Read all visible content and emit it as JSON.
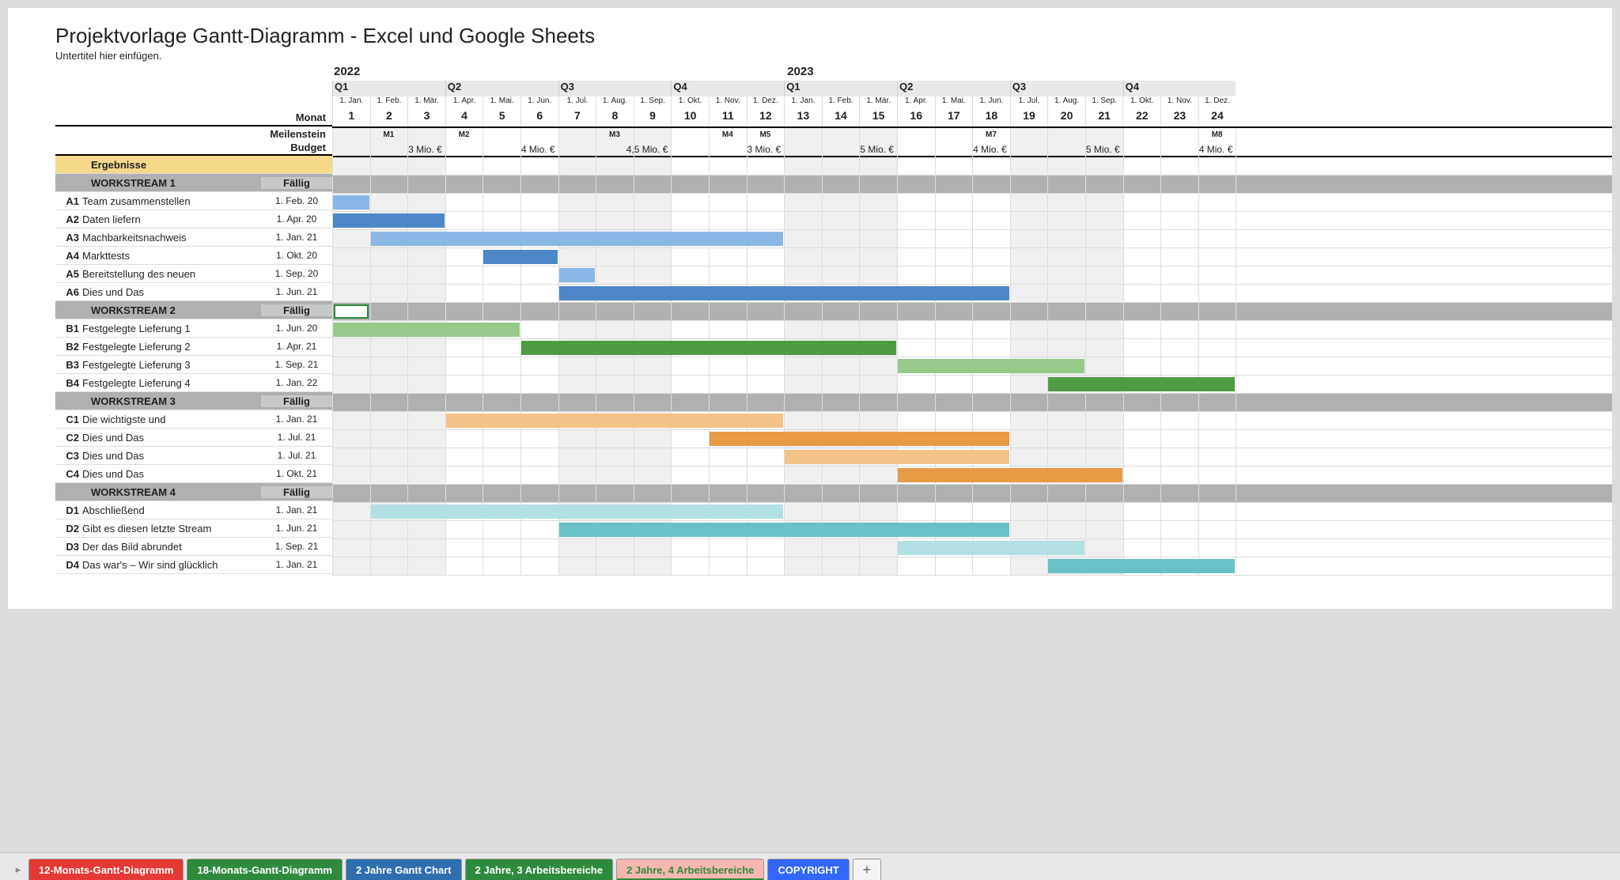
{
  "title": "Projektvorlage Gantt-Diagramm - Excel und Google Sheets",
  "subtitle": "Untertitel hier einfügen.",
  "left_headers": {
    "monat": "Monat",
    "meilenstein": "Meilenstein",
    "budget": "Budget",
    "ergebnisse": "Ergebnisse",
    "fallig": "Fällig"
  },
  "years": [
    "2022",
    "2023"
  ],
  "quarters": [
    "Q1",
    "Q2",
    "Q3",
    "Q4",
    "Q1",
    "Q2",
    "Q3",
    "Q4"
  ],
  "month_dates": [
    "1. Jan.",
    "1. Feb.",
    "1. Mär.",
    "1. Apr.",
    "1. Mai.",
    "1. Jun.",
    "1. Jul.",
    "1. Aug.",
    "1. Sep.",
    "1. Okt.",
    "1. Nov.",
    "1. Dez.",
    "1. Jan.",
    "1. Feb.",
    "1. Mär.",
    "1. Apr.",
    "1. Mai.",
    "1. Jun.",
    "1. Jul.",
    "1. Aug.",
    "1. Sep.",
    "1. Okt.",
    "1. Nov.",
    "1. Dez."
  ],
  "month_nums": [
    "1",
    "2",
    "3",
    "4",
    "5",
    "6",
    "7",
    "8",
    "9",
    "10",
    "11",
    "12",
    "13",
    "14",
    "15",
    "16",
    "17",
    "18",
    "19",
    "20",
    "21",
    "22",
    "23",
    "24"
  ],
  "milestones": [
    {
      "col": 2,
      "label": "M1"
    },
    {
      "col": 4,
      "label": "M2"
    },
    {
      "col": 8,
      "label": "M3"
    },
    {
      "col": 11,
      "label": "M4"
    },
    {
      "col": 12,
      "label": "M5"
    },
    {
      "col": 18,
      "label": "M7"
    },
    {
      "col": 24,
      "label": "M8"
    }
  ],
  "budgets": [
    {
      "end_col": 3,
      "label": "3 Mio. €"
    },
    {
      "end_col": 6,
      "label": "4 Mio. €"
    },
    {
      "end_col": 9,
      "label": "4,5 Mio. €"
    },
    {
      "end_col": 12,
      "label": "3 Mio. €"
    },
    {
      "end_col": 15,
      "label": "5 Mio. €"
    },
    {
      "end_col": 18,
      "label": "4 Mio. €"
    },
    {
      "end_col": 21,
      "label": "5 Mio. €"
    },
    {
      "end_col": 24,
      "label": "4 Mio. €"
    }
  ],
  "workstreams": [
    {
      "name": "WORKSTREAM 1",
      "color_light": "#8ab7e6",
      "color_dark": "#4d87c7",
      "select_first_cell": false,
      "tasks": [
        {
          "id": "A1",
          "name": "Team zusammenstellen",
          "due": "1. Feb. 20",
          "start": 1,
          "len": 1,
          "shade": "light"
        },
        {
          "id": "A2",
          "name": "Daten liefern",
          "due": "1. Apr. 20",
          "start": 1,
          "len": 3,
          "shade": "dark"
        },
        {
          "id": "A3",
          "name": "Machbarkeitsnachweis",
          "due": "1. Jan. 21",
          "start": 2,
          "len": 11,
          "shade": "light"
        },
        {
          "id": "A4",
          "name": "Markttests",
          "due": "1. Okt. 20",
          "start": 5,
          "len": 2,
          "shade": "dark"
        },
        {
          "id": "A5",
          "name": "Bereitstellung des neuen",
          "due": "1. Sep. 20",
          "start": 7,
          "len": 1,
          "shade": "light"
        },
        {
          "id": "A6",
          "name": "Dies und Das",
          "due": "1. Jun. 21",
          "start": 7,
          "len": 12,
          "shade": "dark"
        }
      ]
    },
    {
      "name": "WORKSTREAM 2",
      "color_light": "#96c98a",
      "color_dark": "#4f9b44",
      "select_first_cell": true,
      "tasks": [
        {
          "id": "B1",
          "name": "Festgelegte Lieferung 1",
          "due": "1. Jun. 20",
          "start": 1,
          "len": 5,
          "shade": "light"
        },
        {
          "id": "B2",
          "name": "Festgelegte Lieferung 2",
          "due": "1. Apr. 21",
          "start": 6,
          "len": 10,
          "shade": "dark"
        },
        {
          "id": "B3",
          "name": "Festgelegte Lieferung 3",
          "due": "1. Sep. 21",
          "start": 16,
          "len": 5,
          "shade": "light"
        },
        {
          "id": "B4",
          "name": "Festgelegte Lieferung 4",
          "due": "1. Jan. 22",
          "start": 20,
          "len": 5,
          "shade": "dark"
        }
      ]
    },
    {
      "name": "WORKSTREAM 3",
      "color_light": "#f3c38a",
      "color_dark": "#e89a45",
      "select_first_cell": false,
      "tasks": [
        {
          "id": "C1",
          "name": "Die wichtigste und",
          "due": "1. Jan. 21",
          "start": 4,
          "len": 9,
          "shade": "light"
        },
        {
          "id": "C2",
          "name": "Dies und Das",
          "due": "1. Jul. 21",
          "start": 11,
          "len": 8,
          "shade": "dark"
        },
        {
          "id": "C3",
          "name": "Dies und Das",
          "due": "1. Jul. 21",
          "start": 13,
          "len": 6,
          "shade": "light"
        },
        {
          "id": "C4",
          "name": "Dies und Das",
          "due": "1. Okt. 21",
          "start": 16,
          "len": 6,
          "shade": "dark"
        }
      ]
    },
    {
      "name": "WORKSTREAM 4",
      "color_light": "#b2e0e2",
      "color_dark": "#6ac1c6",
      "select_first_cell": false,
      "tasks": [
        {
          "id": "D1",
          "name": "Abschließend",
          "due": "1. Jan. 21",
          "start": 2,
          "len": 11,
          "shade": "light"
        },
        {
          "id": "D2",
          "name": "Gibt es diesen letzte Stream",
          "due": "1. Jun. 21",
          "start": 7,
          "len": 12,
          "shade": "dark"
        },
        {
          "id": "D3",
          "name": "Der das Bild abrundet",
          "due": "1. Sep. 21",
          "start": 16,
          "len": 5,
          "shade": "light"
        },
        {
          "id": "D4",
          "name": "Das war's – Wir sind glücklich",
          "due": "1. Jan. 21",
          "start": 20,
          "len": 5,
          "shade": "dark"
        }
      ]
    }
  ],
  "tabs": [
    {
      "label": "12-Monats-Gantt-Diagramm",
      "bg": "#e53935",
      "fg": "#fff",
      "active": false
    },
    {
      "label": "18-Monats-Gantt-Diagramm",
      "bg": "#2e8b3d",
      "fg": "#fff",
      "active": false
    },
    {
      "label": "2 Jahre Gantt Chart",
      "bg": "#2f6fb0",
      "fg": "#fff",
      "active": false
    },
    {
      "label": "2 Jahre, 3 Arbeitsbereiche",
      "bg": "#2e8b3d",
      "fg": "#fff",
      "active": false
    },
    {
      "label": "2 Jahre, 4 Arbeitsbereiche",
      "bg": "#f5b7b1",
      "fg": "#2e8b3d",
      "active": true
    },
    {
      "label": "COPYRIGHT",
      "bg": "#3366ff",
      "fg": "#fff",
      "active": false
    }
  ],
  "chart_data": {
    "type": "bar",
    "orientation": "gantt",
    "title": "Projektvorlage Gantt-Diagramm - Excel und Google Sheets",
    "xlabel": "Monat",
    "x_range": [
      1,
      24
    ],
    "x_tick_labels": [
      "1. Jan. 2022",
      "1. Feb. 2022",
      "1. Mär. 2022",
      "1. Apr. 2022",
      "1. Mai. 2022",
      "1. Jun. 2022",
      "1. Jul. 2022",
      "1. Aug. 2022",
      "1. Sep. 2022",
      "1. Okt. 2022",
      "1. Nov. 2022",
      "1. Dez. 2022",
      "1. Jan. 2023",
      "1. Feb. 2023",
      "1. Mär. 2023",
      "1. Apr. 2023",
      "1. Mai. 2023",
      "1. Jun. 2023",
      "1. Jul. 2023",
      "1. Aug. 2023",
      "1. Sep. 2023",
      "1. Okt. 2023",
      "1. Nov. 2023",
      "1. Dez. 2023"
    ],
    "milestones": {
      "M1": 2,
      "M2": 4,
      "M3": 8,
      "M4": 11,
      "M5": 12,
      "M7": 18,
      "M8": 24
    },
    "budget_per_quarter_million_eur": [
      3,
      4,
      4.5,
      3,
      5,
      4,
      5,
      4
    ],
    "series": [
      {
        "group": "WORKSTREAM 1",
        "name": "A1 Team zusammenstellen",
        "start": 1,
        "end": 1
      },
      {
        "group": "WORKSTREAM 1",
        "name": "A2 Daten liefern",
        "start": 1,
        "end": 3
      },
      {
        "group": "WORKSTREAM 1",
        "name": "A3 Machbarkeitsnachweis",
        "start": 2,
        "end": 12
      },
      {
        "group": "WORKSTREAM 1",
        "name": "A4 Markttests",
        "start": 5,
        "end": 6
      },
      {
        "group": "WORKSTREAM 1",
        "name": "A5 Bereitstellung des neuen",
        "start": 7,
        "end": 7
      },
      {
        "group": "WORKSTREAM 1",
        "name": "A6 Dies und Das",
        "start": 7,
        "end": 18
      },
      {
        "group": "WORKSTREAM 2",
        "name": "B1 Festgelegte Lieferung 1",
        "start": 1,
        "end": 5
      },
      {
        "group": "WORKSTREAM 2",
        "name": "B2 Festgelegte Lieferung 2",
        "start": 6,
        "end": 15
      },
      {
        "group": "WORKSTREAM 2",
        "name": "B3 Festgelegte Lieferung 3",
        "start": 16,
        "end": 20
      },
      {
        "group": "WORKSTREAM 2",
        "name": "B4 Festgelegte Lieferung 4",
        "start": 20,
        "end": 24
      },
      {
        "group": "WORKSTREAM 3",
        "name": "C1 Die wichtigste und",
        "start": 4,
        "end": 12
      },
      {
        "group": "WORKSTREAM 3",
        "name": "C2 Dies und Das",
        "start": 11,
        "end": 18
      },
      {
        "group": "WORKSTREAM 3",
        "name": "C3 Dies und Das",
        "start": 13,
        "end": 18
      },
      {
        "group": "WORKSTREAM 3",
        "name": "C4 Dies und Das",
        "start": 16,
        "end": 21
      },
      {
        "group": "WORKSTREAM 4",
        "name": "D1 Abschließend",
        "start": 2,
        "end": 12
      },
      {
        "group": "WORKSTREAM 4",
        "name": "D2 Gibt es diesen letzte Stream",
        "start": 7,
        "end": 18
      },
      {
        "group": "WORKSTREAM 4",
        "name": "D3 Der das Bild abrundet",
        "start": 16,
        "end": 20
      },
      {
        "group": "WORKSTREAM 4",
        "name": "D4 Das war's – Wir sind glücklich",
        "start": 20,
        "end": 24
      }
    ]
  }
}
